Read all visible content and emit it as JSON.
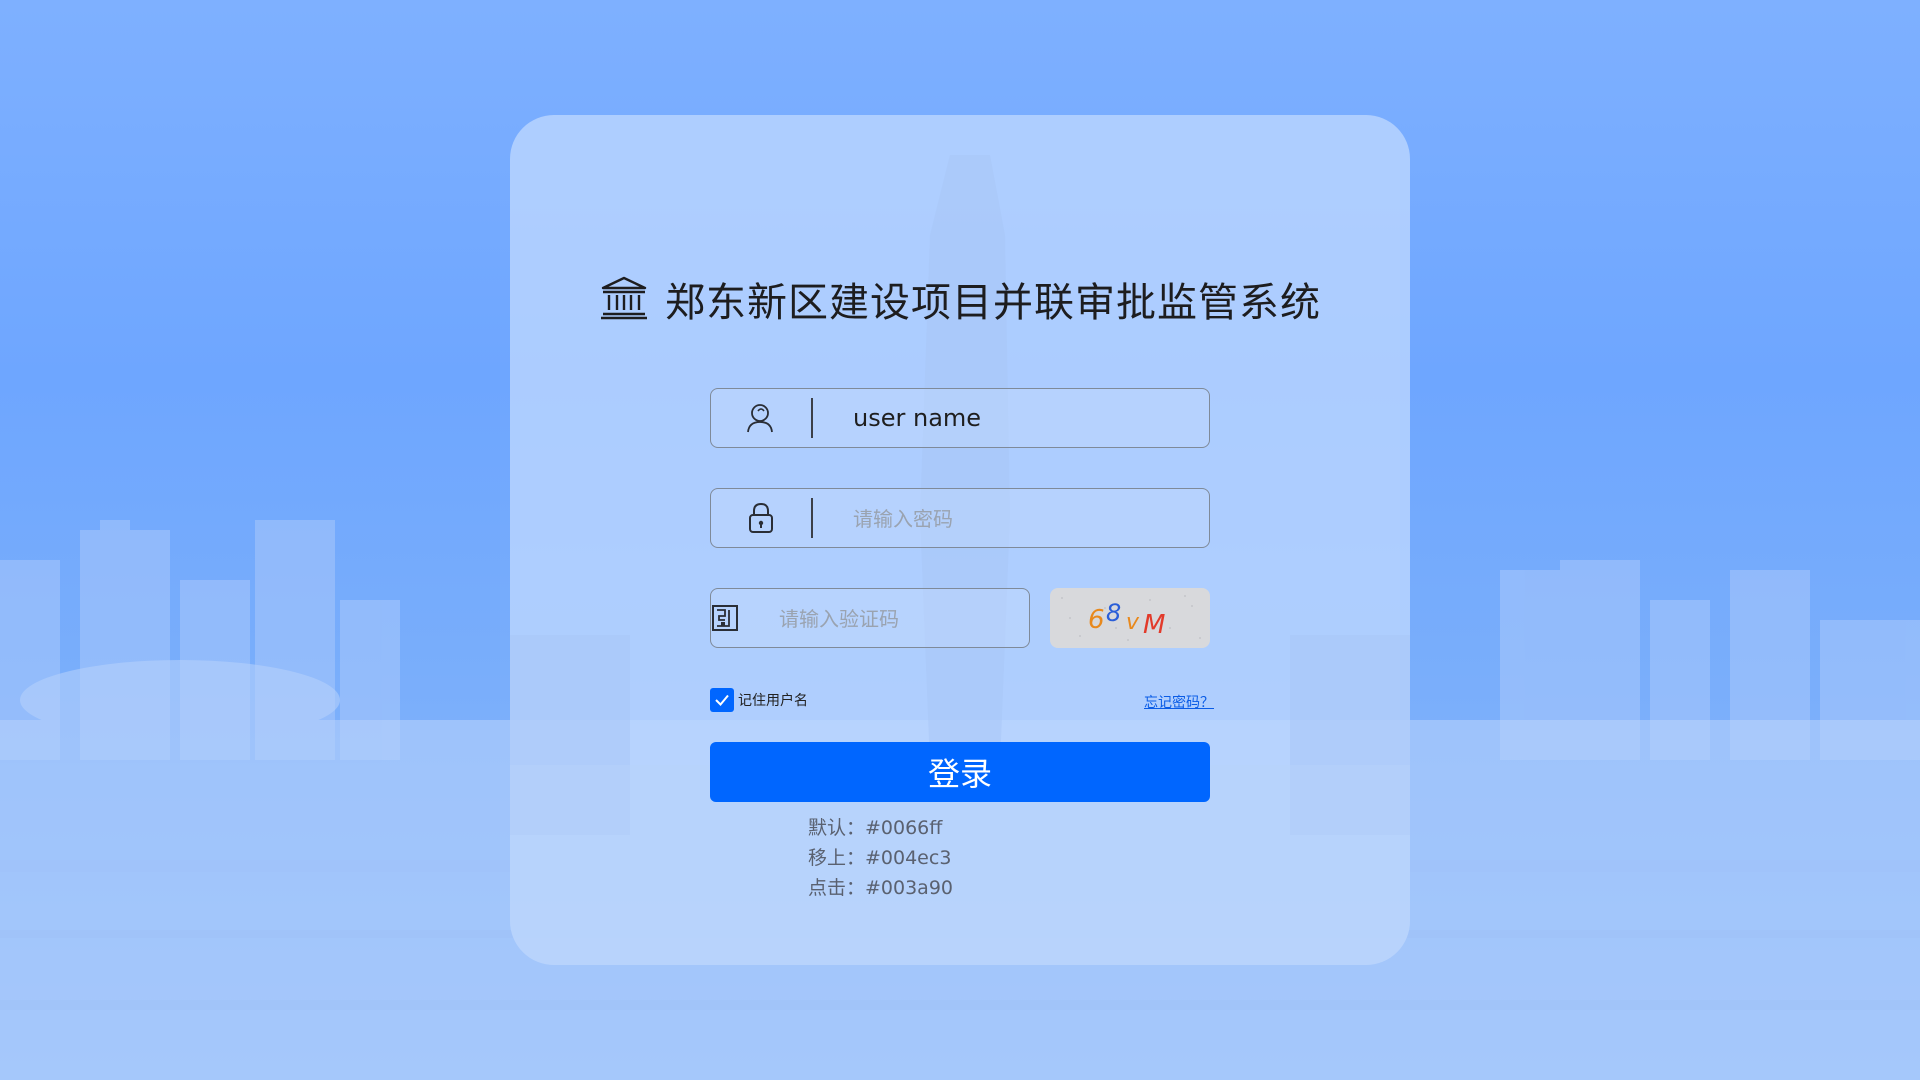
{
  "page": {
    "title": "郑东新区建设项目并联审批监管系统"
  },
  "form": {
    "username": {
      "value": "user name",
      "placeholder": ""
    },
    "password": {
      "value": "",
      "placeholder": "请输入密码"
    },
    "captcha": {
      "value": "",
      "placeholder": "请输入验证码",
      "image_text": "68vM"
    },
    "remember_label": "记住用户名",
    "remember_checked": true,
    "forgot_label": "忘记密码？",
    "login_label": "登录"
  },
  "notes": [
    "默认：#0066ff",
    "移上：#004ec3",
    "点击：#003a90"
  ],
  "colors": {
    "primary": "#0066ff",
    "hover": "#004ec3",
    "active": "#003a90"
  },
  "icons": {
    "title": "bank-building-icon",
    "username": "user-icon",
    "password": "lock-icon",
    "captcha": "captcha-grid-icon",
    "checkbox": "check-icon"
  }
}
